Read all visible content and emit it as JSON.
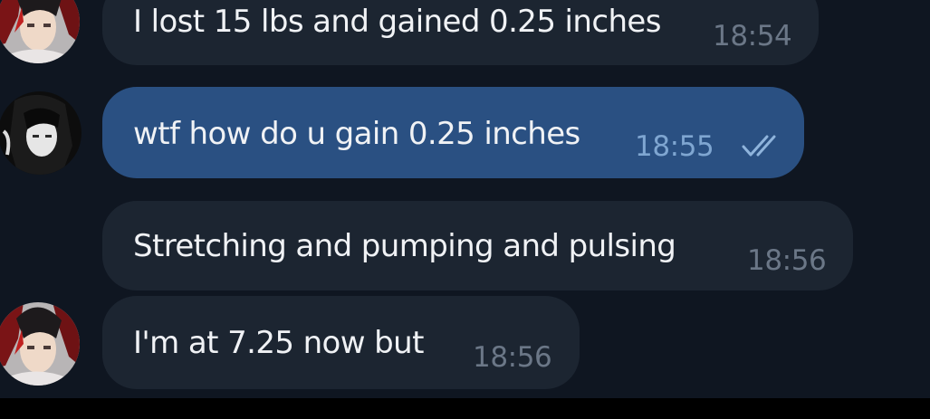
{
  "messages": [
    {
      "text": "I lost 15 lbs and gained 0.25 inches",
      "time": "18:54",
      "direction": "incoming"
    },
    {
      "text": "wtf how do u gain 0.25 inches",
      "time": "18:55",
      "direction": "outgoing",
      "status": "read"
    },
    {
      "text": "Stretching and pumping and pulsing",
      "time": "18:56",
      "direction": "incoming"
    },
    {
      "text": "I'm at 7.25 now but",
      "time": "18:56",
      "direction": "incoming"
    }
  ],
  "icons": {
    "read_ticks": "double-check-icon"
  },
  "colors": {
    "background": "#0f1621",
    "incoming_bubble": "#1c2531",
    "outgoing_bubble": "#2a5082",
    "text": "#f0f2f5",
    "incoming_time": "#6b7787",
    "outgoing_time": "#7fa6d1",
    "ticks": "#8fb4dc"
  }
}
